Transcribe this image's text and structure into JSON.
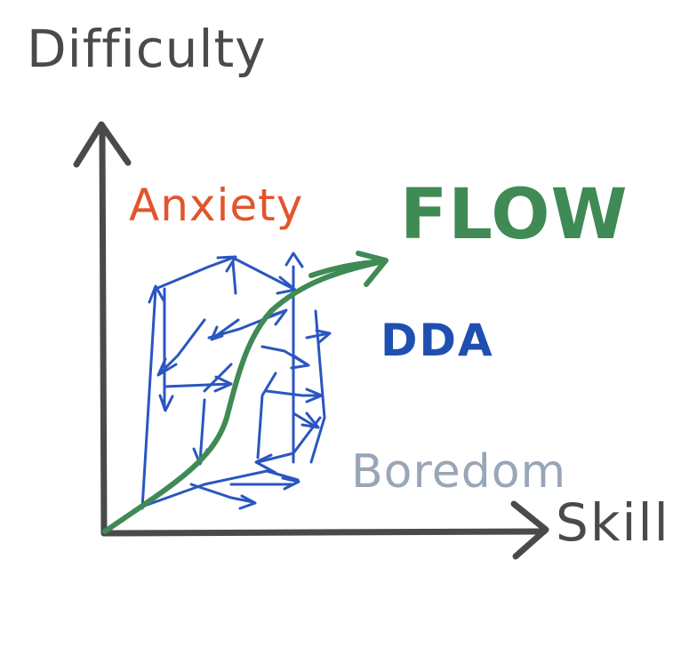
{
  "labels": {
    "y_axis": "Difficulty",
    "x_axis": "Skill",
    "anxiety": "Anxiety",
    "flow": "FLOW",
    "dda": "DDA",
    "boredom": "Boredom"
  },
  "colors": {
    "axis": "#4a4a4a",
    "anxiety": "#e2552c",
    "flow": "#3f8a55",
    "dda": "#1f4fb0",
    "arrows": "#2a56c0",
    "boredom": "#98a6b8"
  }
}
